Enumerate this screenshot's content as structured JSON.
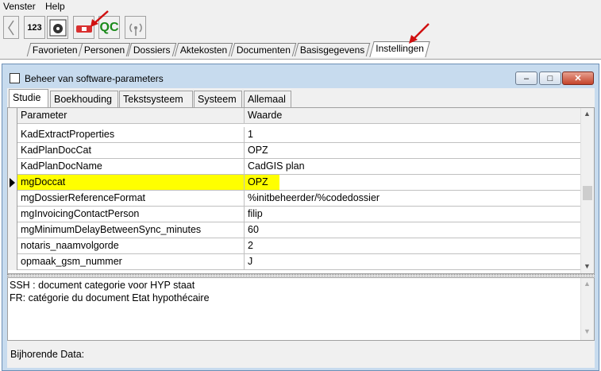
{
  "menu": [
    "Venster",
    "Help"
  ],
  "toolbar": {
    "icons": [
      "back-arrow-icon",
      "numbers-123-icon",
      "gear-grid-icon",
      "tools-icon",
      "qc-icon",
      "wireless-icon"
    ],
    "qc_label": "QC",
    "numbers_label": "123"
  },
  "nav_tabs": [
    "Favorieten",
    "Personen",
    "Dossiers",
    "Aktekosten",
    "Documenten",
    "Basisgegevens",
    "Instellingen"
  ],
  "window": {
    "title": "Beheer van software-parameters",
    "subtabs": [
      "Studie",
      "Boekhouding",
      "Tekstsysteem",
      "Systeem",
      "Allemaal"
    ],
    "active_subtab": "Studie"
  },
  "grid": {
    "headers": [
      "Parameter",
      "Waarde"
    ],
    "rows": [
      {
        "param": "KadExtractProperties",
        "value": "1"
      },
      {
        "param": "KadPlanDocCat",
        "value": "OPZ"
      },
      {
        "param": "KadPlanDocName",
        "value": "CadGIS plan"
      },
      {
        "param": "mgDoccat",
        "value": "OPZ",
        "selected": true
      },
      {
        "param": "mgDossierReferenceFormat",
        "value": "%initbeheerder/%codedossier"
      },
      {
        "param": "mgInvoicingContactPerson",
        "value": "filip"
      },
      {
        "param": "mgMinimumDelayBetweenSync_minutes",
        "value": "60"
      },
      {
        "param": "notaris_naamvolgorde",
        "value": "2"
      },
      {
        "param": "opmaak_gsm_nummer",
        "value": "J"
      }
    ]
  },
  "memo": {
    "lines": [
      "SSH : document categorie voor HYP staat",
      "FR: catégorie du document Etat hypothécaire"
    ]
  },
  "footer_label": "Bijhorende Data:",
  "colors": {
    "highlight": "#ffff00",
    "window_frame": "#c7dbee",
    "annotation_arrow": "#d01010"
  }
}
